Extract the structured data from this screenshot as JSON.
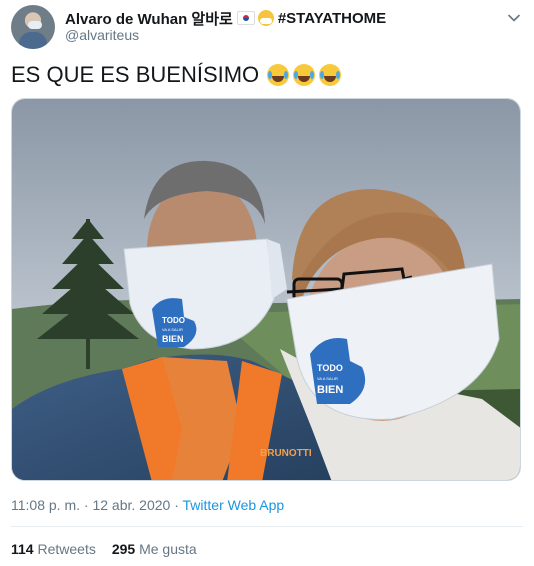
{
  "tweet": {
    "display_name": "Alvaro de Wuhan 알바로",
    "emoji_flag": "south-korea-flag-icon",
    "emoji_mask": "face-with-mask-icon",
    "hashtag": "#STAYATHOME",
    "handle": "@alvariteus",
    "text": "ES QUE ES BUENÍSIMO",
    "text_emojis": [
      "laughing-tears-icon",
      "laughing-tears-icon",
      "laughing-tears-icon"
    ],
    "mask_text_line1": "TODO",
    "mask_text_line2": "VA A SALIR",
    "mask_text_line3": "BIEN",
    "jacket_brand": "BRUNOTTI",
    "time": "11:08 p. m.",
    "separator": " · ",
    "date": "12 abr. 2020",
    "source": "Twitter Web App",
    "retweets_count": "114",
    "retweets_label": "Retweets",
    "likes_count": "295",
    "likes_label": "Me gusta"
  },
  "colors": {
    "link": "#1b95e0",
    "secondary_text": "#657786",
    "primary_text": "#14171a"
  }
}
